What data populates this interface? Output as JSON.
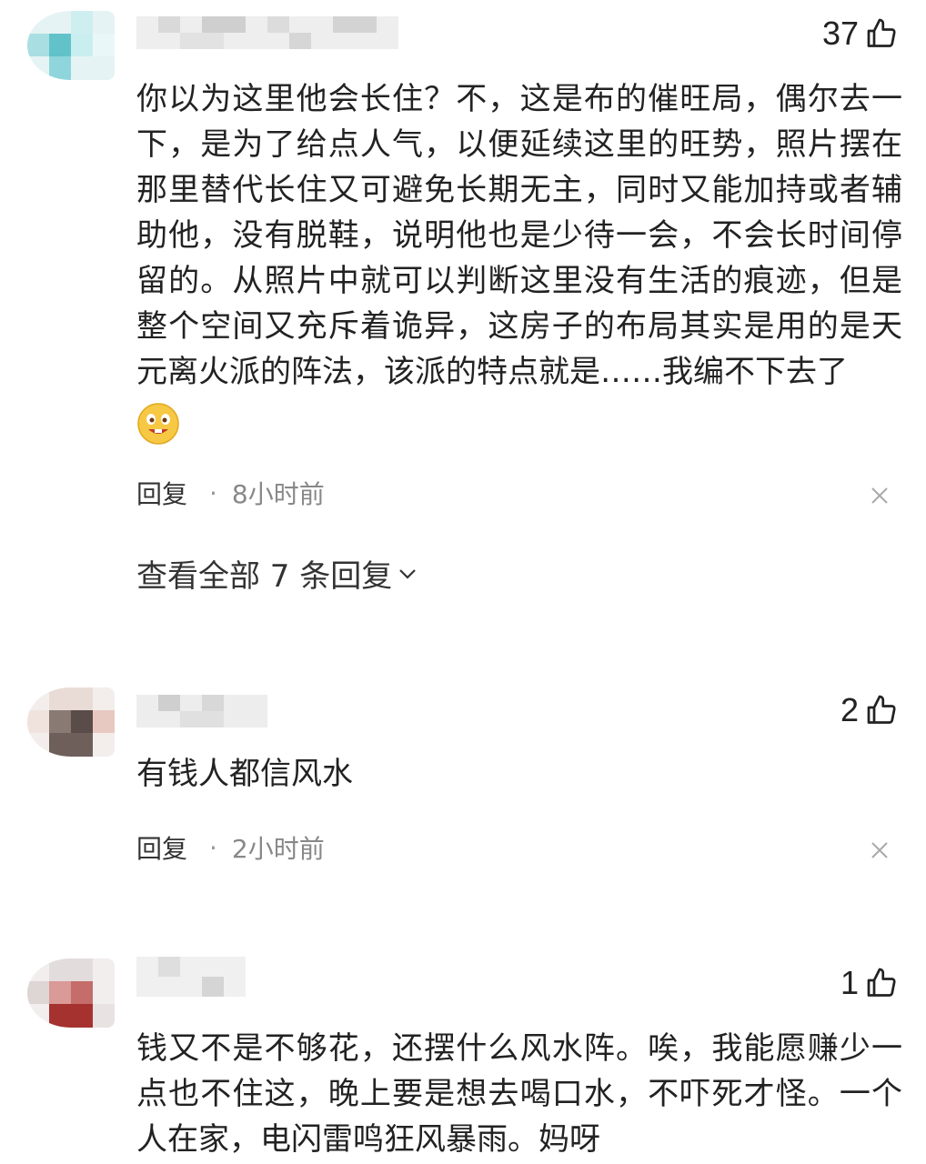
{
  "comments": [
    {
      "likes": "37",
      "text": "你以为这里他会长住？不，这是布的催旺局，偶尔去一下，是为了给点人气，以便延续这里的旺势，照片摆在那里替代长住又可避免长期无主，同时又能加持或者辅助他，没有脱鞋，说明他也是少待一会，不会长时间停留的。从照片中就可以判断这里没有生活的痕迹，但是整个空间又充斥着诡异，这房子的布局其实是用的是天元离火派的阵法，该派的特点就是……我编不下去了",
      "emoji": "grinning-face-emoji",
      "reply_label": "回复",
      "separator": "·",
      "time": "8小时前",
      "view_replies": "查看全部 7 条回复"
    },
    {
      "likes": "2",
      "text": "有钱人都信风水",
      "reply_label": "回复",
      "separator": "·",
      "time": "2小时前"
    },
    {
      "likes": "1",
      "text": "钱又不是不够花，还摆什么风水阵。唉，我能愿赚少一点也不住这，晚上要是想去喝口水，不吓死才怪。一个人在家，电闪雷鸣狂风暴雨。妈呀"
    }
  ],
  "icons": {
    "like": "thumbs-up-icon",
    "close": "close-icon",
    "expand": "chevron-down-icon"
  }
}
